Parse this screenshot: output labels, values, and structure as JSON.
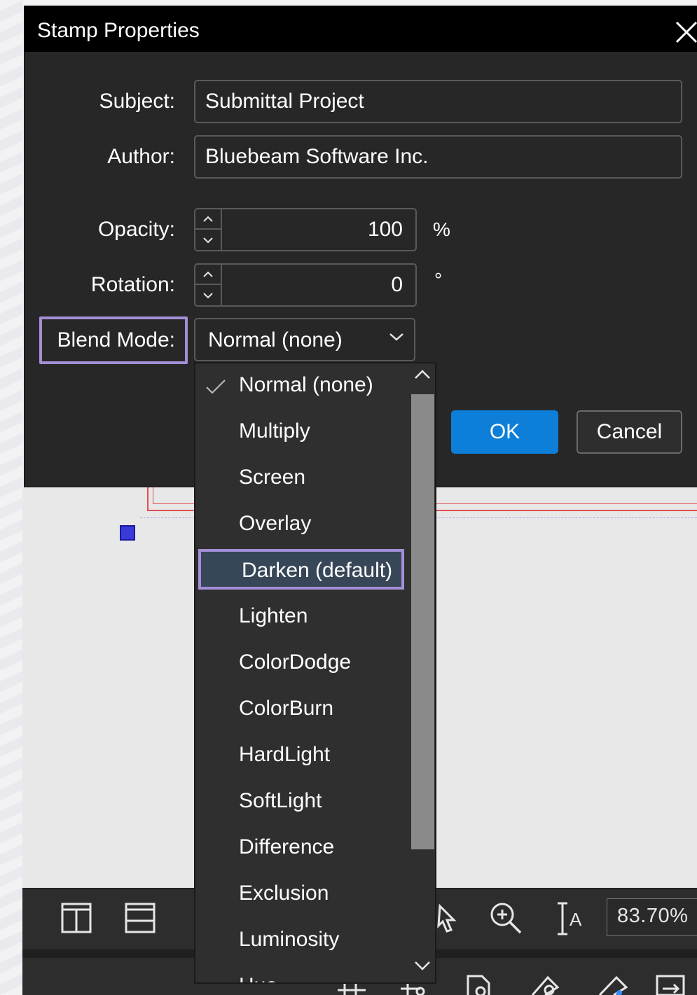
{
  "dialog": {
    "title": "Stamp Properties",
    "subject_label": "Subject:",
    "subject_value": "Submittal Project",
    "author_label": "Author:",
    "author_value": "Bluebeam Software Inc.",
    "opacity_label": "Opacity:",
    "opacity_value": "100",
    "opacity_unit": "%",
    "rotation_label": "Rotation:",
    "rotation_value": "0",
    "rotation_unit": "°",
    "blend_label": "Blend Mode:",
    "blend_value": "Normal (none)",
    "ok_label": "OK",
    "cancel_label": "Cancel"
  },
  "blend_options": [
    "Normal (none)",
    "Multiply",
    "Screen",
    "Overlay",
    "Darken (default)",
    "Lighten",
    "ColorDodge",
    "ColorBurn",
    "HardLight",
    "SoftLight",
    "Difference",
    "Exclusion",
    "Luminosity",
    "Hue"
  ],
  "blend_checked": "Normal (none)",
  "blend_highlighted": "Darken (default)",
  "status": {
    "zoom": "83.70%"
  },
  "colors": {
    "accent": "#0d7fd9",
    "highlight_outline": "#a48fd6",
    "dialog_bg": "#272727"
  }
}
